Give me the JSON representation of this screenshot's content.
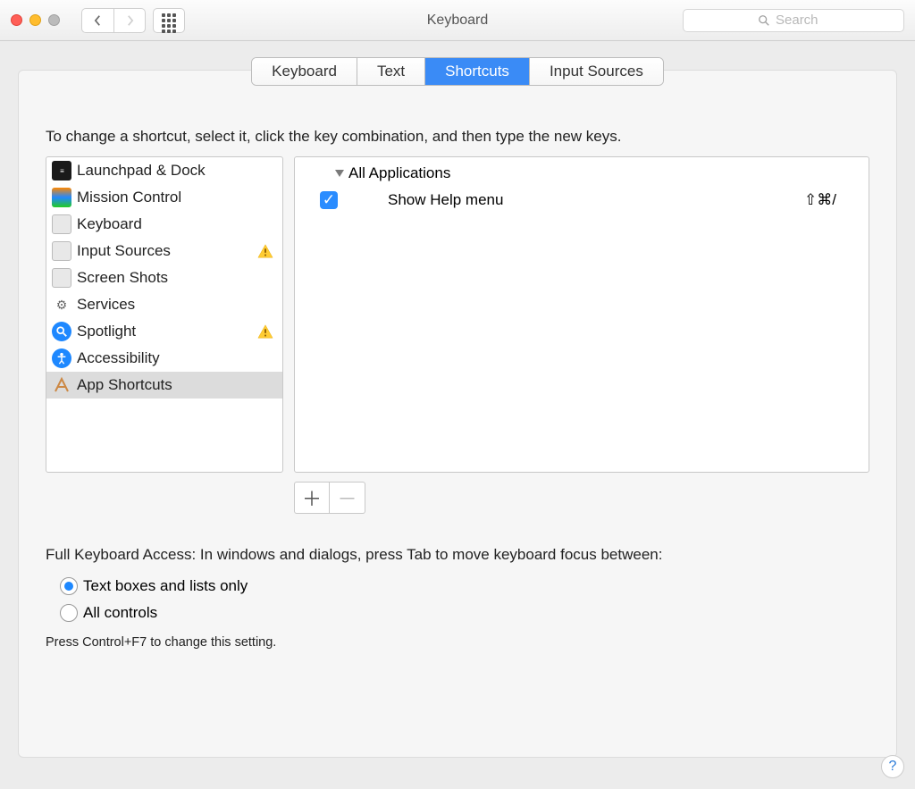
{
  "window": {
    "title": "Keyboard"
  },
  "search": {
    "placeholder": "Search"
  },
  "tabs": [
    {
      "label": "Keyboard",
      "active": false
    },
    {
      "label": "Text",
      "active": false
    },
    {
      "label": "Shortcuts",
      "active": true
    },
    {
      "label": "Input Sources",
      "active": false
    }
  ],
  "instructions": "To change a shortcut, select it, click the key combination, and then type the new keys.",
  "categories": [
    {
      "label": "Launchpad & Dock",
      "icon": "launchpad",
      "warn": false,
      "selected": false
    },
    {
      "label": "Mission Control",
      "icon": "mission",
      "warn": false,
      "selected": false
    },
    {
      "label": "Keyboard",
      "icon": "keyboard",
      "warn": false,
      "selected": false
    },
    {
      "label": "Input Sources",
      "icon": "inputsrc",
      "warn": true,
      "selected": false
    },
    {
      "label": "Screen Shots",
      "icon": "screenshots",
      "warn": false,
      "selected": false
    },
    {
      "label": "Services",
      "icon": "services",
      "warn": false,
      "selected": false
    },
    {
      "label": "Spotlight",
      "icon": "spotlight",
      "warn": true,
      "selected": false
    },
    {
      "label": "Accessibility",
      "icon": "accessibility",
      "warn": false,
      "selected": false
    },
    {
      "label": "App Shortcuts",
      "icon": "appshortcuts",
      "warn": false,
      "selected": true
    }
  ],
  "shortcuts": {
    "group": "All Applications",
    "items": [
      {
        "enabled": true,
        "label": "Show Help menu",
        "keys": "⇧⌘/"
      }
    ]
  },
  "fka": {
    "heading": "Full Keyboard Access: In windows and dialogs, press Tab to move keyboard focus between:",
    "options": [
      {
        "label": "Text boxes and lists only",
        "selected": true
      },
      {
        "label": "All controls",
        "selected": false
      }
    ],
    "hint": "Press Control+F7 to change this setting."
  },
  "icons": {
    "gear": "⚙︎",
    "mag": "🔍",
    "acc": "♿︎",
    "app": "𝖠",
    "check": "✓"
  }
}
